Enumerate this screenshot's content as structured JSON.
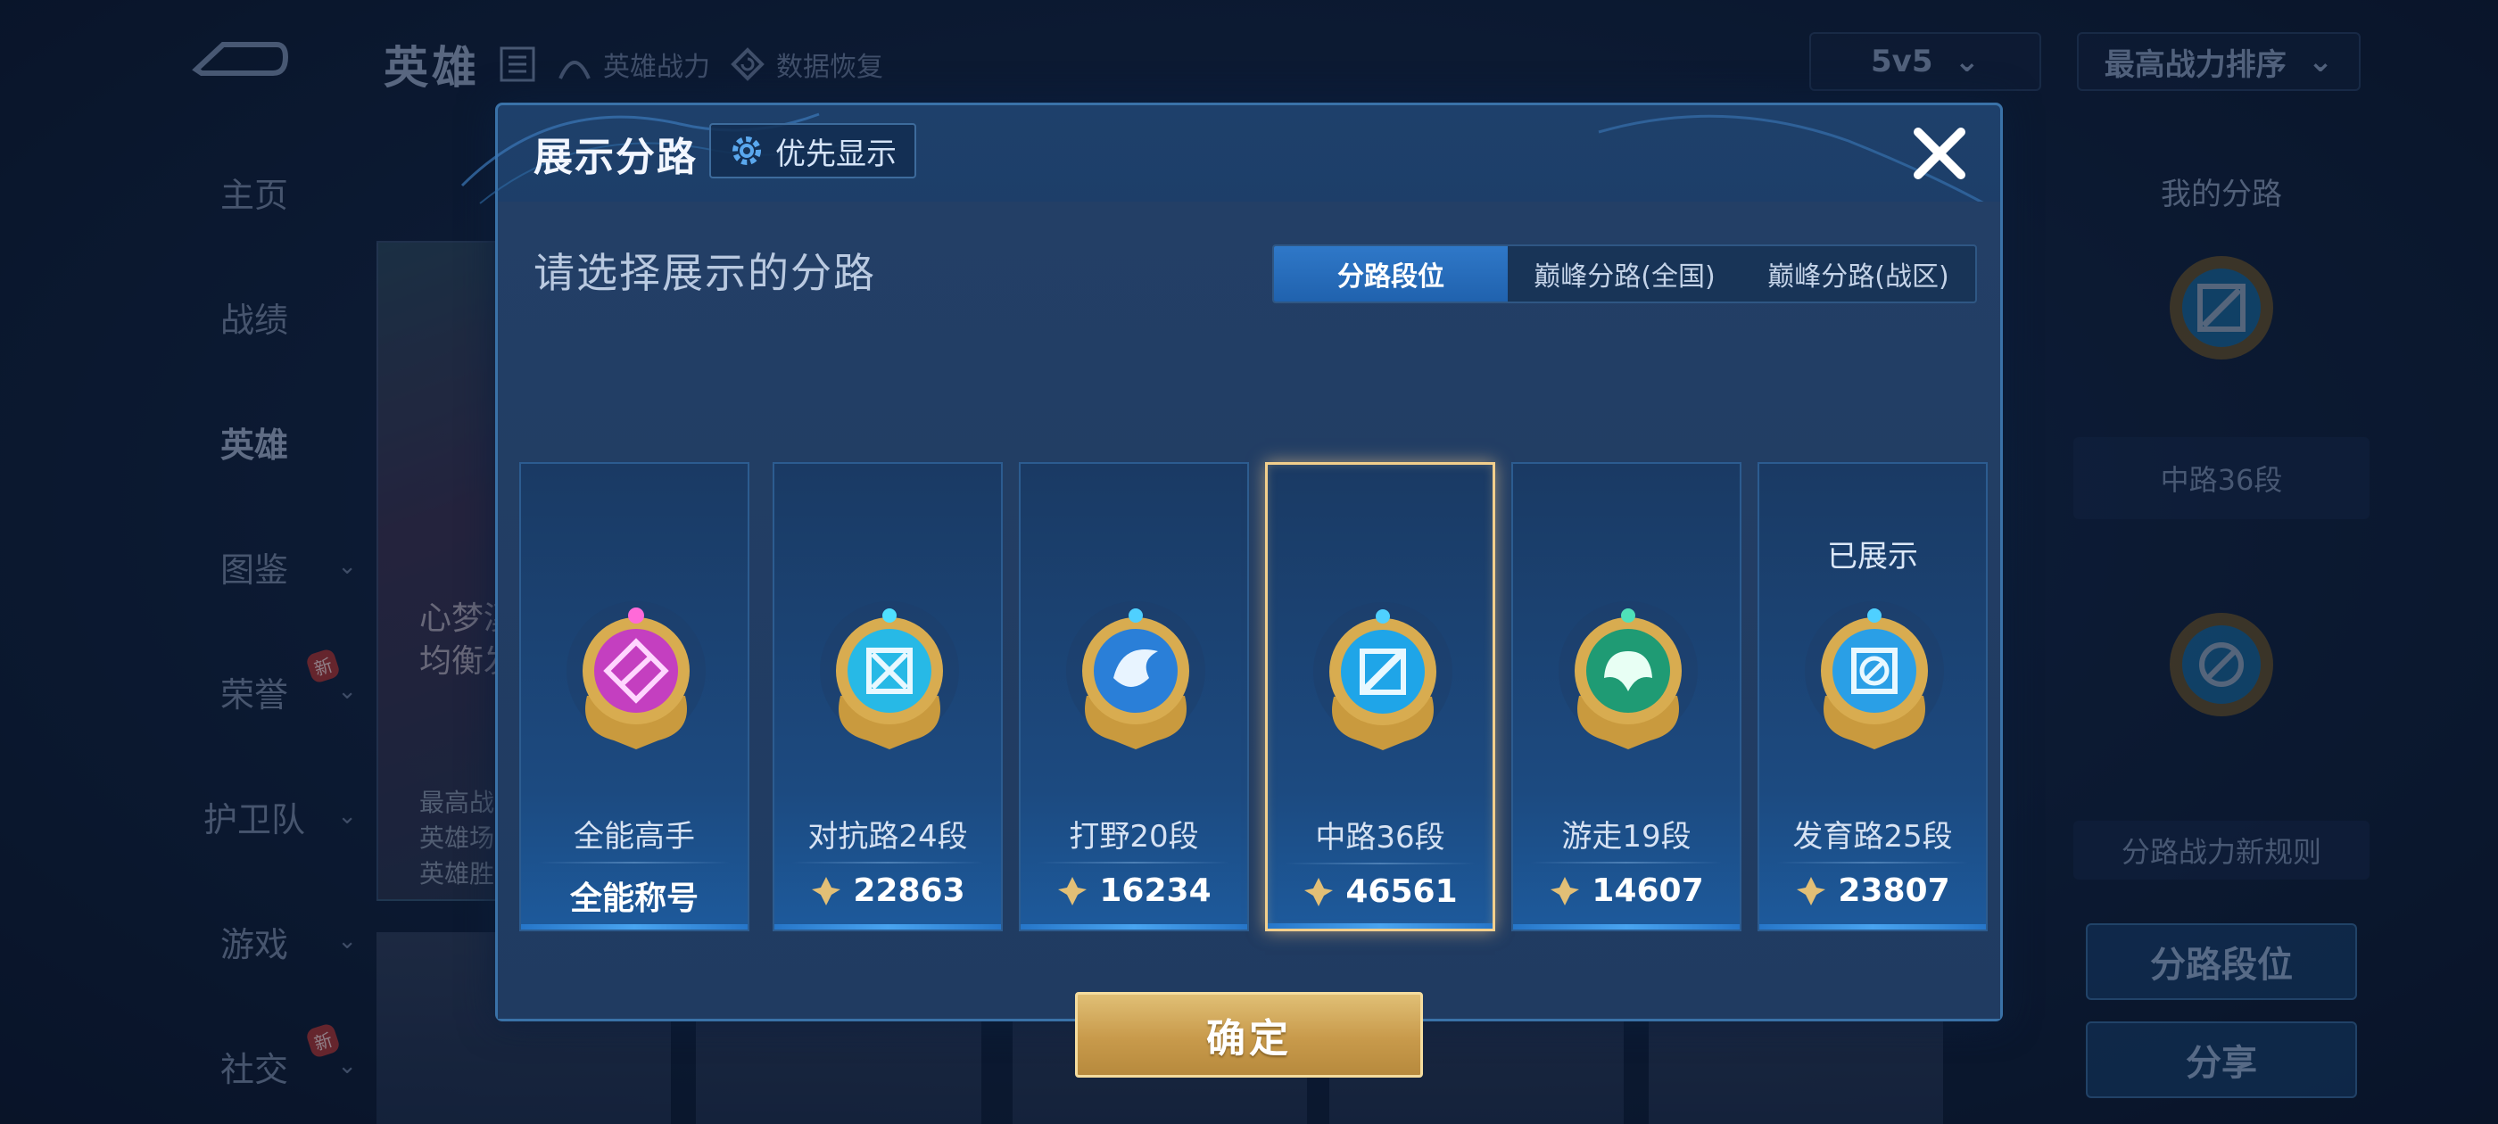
{
  "background": {
    "top_title": "英雄",
    "top_links": [
      "英雄战力",
      "数据恢复"
    ],
    "mode_select": "5v5",
    "sort_select": "最高战力排序",
    "nav_items": [
      {
        "label": "主页",
        "has_chevron": false,
        "is_new": false
      },
      {
        "label": "战绩",
        "has_chevron": false,
        "is_new": false
      },
      {
        "label": "英雄",
        "has_chevron": false,
        "is_new": false,
        "active": true
      },
      {
        "label": "图鉴",
        "has_chevron": true,
        "is_new": false
      },
      {
        "label": "荣誉",
        "has_chevron": true,
        "is_new": true
      },
      {
        "label": "护卫队",
        "has_chevron": true,
        "is_new": false
      },
      {
        "label": "游戏",
        "has_chevron": true,
        "is_new": false
      },
      {
        "label": "社交",
        "has_chevron": true,
        "is_new": true
      }
    ],
    "new_badge": "新",
    "hero_name_partial": [
      "心梦溪",
      "均衡发展"
    ],
    "hero_stats_partial": [
      "最高战",
      "英雄场",
      "英雄胜"
    ],
    "right_panel": {
      "title": "我的分路",
      "lane_label": "中路36段",
      "rule_label": "分路战力新规则",
      "rank_button": "分路段位",
      "share_button": "分享"
    }
  },
  "modal": {
    "title": "展示分路",
    "priority_button": "优先显示",
    "subtitle": "请选择展示的分路",
    "tabs": [
      {
        "label": "分路段位",
        "active": true
      },
      {
        "label": "巅峰分路(全国)",
        "active": false
      },
      {
        "label": "巅峰分路(战区)",
        "active": false
      }
    ],
    "cards": [
      {
        "lane": "全能高手",
        "value": "全能称号",
        "has_power_icon": false,
        "shown": false,
        "selected": false,
        "icon": "all-round-emblem-icon",
        "color": "#c43fc0"
      },
      {
        "lane": "对抗路24段",
        "value": "22863",
        "has_power_icon": true,
        "shown": false,
        "selected": false,
        "icon": "clash-lane-emblem-icon",
        "color": "#27b9e6"
      },
      {
        "lane": "打野20段",
        "value": "16234",
        "has_power_icon": true,
        "shown": false,
        "selected": false,
        "icon": "jungle-emblem-icon",
        "color": "#2a7fd8"
      },
      {
        "lane": "中路36段",
        "value": "46561",
        "has_power_icon": true,
        "shown": false,
        "selected": true,
        "icon": "mid-lane-emblem-icon",
        "color": "#1fa5e8"
      },
      {
        "lane": "游走19段",
        "value": "14607",
        "has_power_icon": true,
        "shown": false,
        "selected": false,
        "icon": "roam-emblem-icon",
        "color": "#1f9b74"
      },
      {
        "lane": "发育路25段",
        "value": "23807",
        "has_power_icon": true,
        "shown": true,
        "shown_label": "已展示",
        "selected": false,
        "icon": "farm-lane-emblem-icon",
        "color": "#2a9fe6"
      }
    ],
    "confirm_button": "确定"
  }
}
